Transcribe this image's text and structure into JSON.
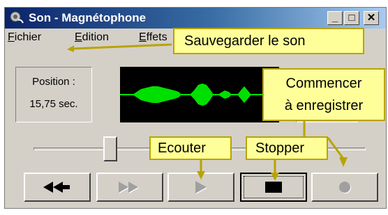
{
  "window": {
    "title": "Son - Magnétophone",
    "controls": {
      "minimize": "_",
      "maximize": "□",
      "close": "✕"
    }
  },
  "menu": {
    "items": [
      {
        "mnemonic": "F",
        "rest": "ichier"
      },
      {
        "mnemonic": "E",
        "rest": "dition"
      },
      {
        "mnemonic": "E",
        "rest": "ffets"
      },
      {
        "mnemonic": "?",
        "rest": ""
      }
    ]
  },
  "position": {
    "label": "Position :",
    "value": "15,75 sec."
  },
  "slider": {
    "position_fraction": 0.24
  },
  "buttons": [
    {
      "name": "rewind-button",
      "icon": "rewind-icon",
      "enabled": true
    },
    {
      "name": "fast-forward-button",
      "icon": "fast-forward-icon",
      "enabled": false
    },
    {
      "name": "play-button",
      "icon": "play-icon",
      "enabled": false
    },
    {
      "name": "stop-button",
      "icon": "stop-icon",
      "enabled": true,
      "focused": true
    },
    {
      "name": "record-button",
      "icon": "record-icon",
      "enabled": false
    }
  ],
  "callouts": {
    "save": "Sauvegarder le son",
    "record_line1": "Commencer",
    "record_line2": "à enregistrer",
    "play": "Ecouter",
    "stop": "Stopper"
  },
  "colors": {
    "title_bar_start": "#0a246a",
    "title_bar_end": "#a6caf0",
    "face": "#d4d0c8",
    "wave_background": "#000000",
    "wave": "#00e000",
    "callout_fill": "#ffff99",
    "callout_border": "#b8a400"
  }
}
